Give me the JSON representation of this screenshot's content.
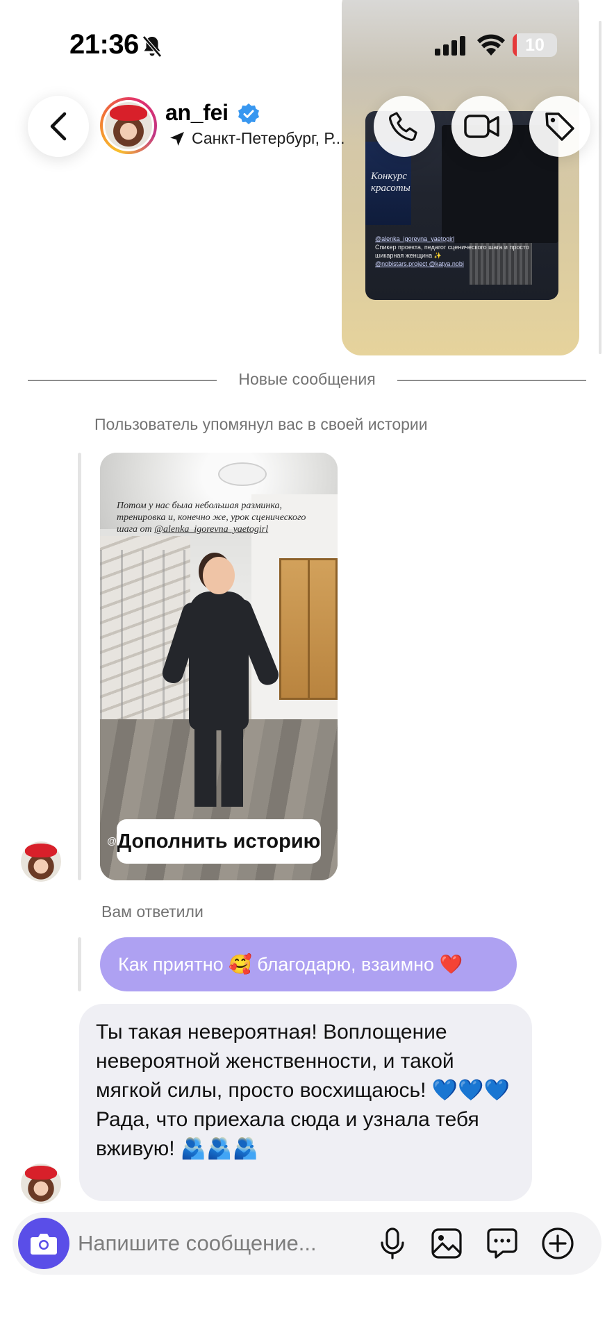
{
  "status_bar": {
    "time": "21:36",
    "battery": "10",
    "battery_level_percent": 10,
    "icons": [
      "bell-off-icon",
      "signal-icon",
      "wifi-icon",
      "battery-icon"
    ]
  },
  "header": {
    "username": "an_fei",
    "verified": true,
    "location": "Санкт-Петербург, Р...",
    "icons": [
      "back-icon",
      "phone-icon",
      "video-icon",
      "tag-icon",
      "location-arrow-icon",
      "verified-badge-icon"
    ]
  },
  "top_story": {
    "banner_text": "Конкурс красоты",
    "caption_mention": "@alenka_igorevna_yaetogirl",
    "caption_text": "Спикер проекта, педагог сценического шага и просто шикарная женщина ✨",
    "caption_mentions_2": "@nobistars.project @katya.nobi"
  },
  "divider": {
    "label": "Новые сообщения"
  },
  "story_mention": {
    "notice": "Пользователь упомянул вас в своей истории",
    "caption_text": "Потом у нас была небольшая разминка, тренировка и, конечно же, урок сценического шага от ",
    "caption_mention": "@alenka_igorevna_yaetogirl",
    "at_sign": "@",
    "add_button_label": "Дополнить историю"
  },
  "reply": {
    "label": "Вам ответили",
    "text": "Как приятно 🥰 благодарю, взаимно ❤️"
  },
  "incoming_message": {
    "line1": "Ты такая невероятная! Воплощение невероятной женственности, и такой мягкой силы, просто восхищаюсь! 💙💙💙",
    "line2": "Рада, что приехала сюда и узнала тебя вживую! 🫂🫂🫂"
  },
  "composer": {
    "placeholder": "Напишите сообщение...",
    "icons": [
      "camera-icon",
      "microphone-icon",
      "gallery-icon",
      "sticker-icon",
      "plus-icon"
    ]
  },
  "colors": {
    "accent": "#5a4ee8",
    "my_bubble": "#aea1f2",
    "their_bubble": "#efeff4",
    "verified": "#3897f0",
    "battery_low": "#e5393a"
  }
}
